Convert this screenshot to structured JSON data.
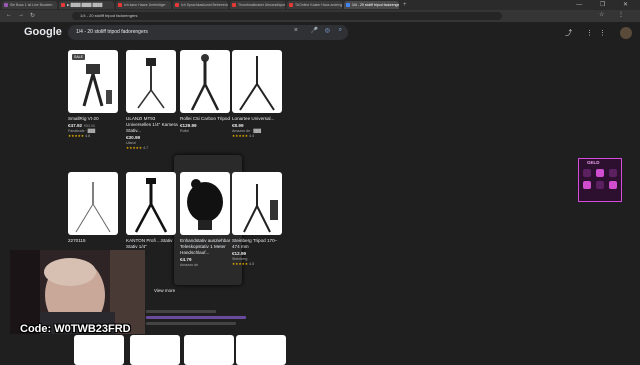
{
  "browser": {
    "tabs": [
      {
        "label": "Sie Boss 1 ist Live Boosten",
        "color": "#9b59b6",
        "active": false
      },
      {
        "label": "▶ ████ ████ ████",
        "color": "#e53935",
        "active": false
      },
      {
        "label": "Ich kann Haare Umfeldiger",
        "color": "#e53935",
        "active": false
      },
      {
        "label": "Ich Sprachkaskunst Betreeedung",
        "color": "#e53935",
        "active": false
      },
      {
        "label": "Thumbnailmaker Alexandrique",
        "color": "#e53935",
        "active": false
      },
      {
        "label": "TAOnline Kaster Haus andringee",
        "color": "#e53935",
        "active": false
      },
      {
        "label": "1/4 - 20 stoliff tripod fadorengers",
        "color": "#4285f4",
        "active": true
      }
    ],
    "new_tab": "+",
    "url": "1/4 - 20 stoliff tripod fadorengers"
  },
  "google": {
    "logo": "Google",
    "query": "1/4 - 20 stoliff tripod fadorengers"
  },
  "products": [
    {
      "name": "SmallRig Vt-20",
      "price": "€47.92",
      "old": "€53.00",
      "store": "Fanaticals · ███",
      "rating": "4.6",
      "badge": "SALE"
    },
    {
      "name": "ULANZI MT93 Universelles 1/4\" Kamera Stativ...",
      "price": "€30.99",
      "old": "",
      "store": "Ulanzi",
      "rating": "4.7",
      "badge": ""
    },
    {
      "name": "Rollei C5i Carbon Tripod",
      "price": "€129.99",
      "old": "",
      "store": "Rollei",
      "rating": "",
      "badge": ""
    },
    {
      "name": "Lonartee Universal...",
      "price": "€8.99",
      "old": "",
      "store": "Amazon.de · ███",
      "rating": "4.4",
      "badge": ""
    },
    {
      "name": "2270115",
      "price": "",
      "old": "",
      "store": "",
      "rating": "",
      "badge": ""
    },
    {
      "name": "KANTON Profi ...Stativ Stativ 1/4\"",
      "price": "",
      "old": "",
      "store": "",
      "rating": "",
      "badge": ""
    },
    {
      "name": "Enhandstativ ausziehbar Teleskopstativ 1 Meter Handschlauf...",
      "price": "€4.79",
      "old": "",
      "store": "Amazon.de",
      "rating": "",
      "badge": ""
    },
    {
      "name": "Steinberg Tripod 170–474 mm",
      "price": "€12.99",
      "old": "",
      "store": "Steinberg",
      "rating": "4.5",
      "badge": ""
    }
  ],
  "view_more": "View more",
  "overlay": {
    "code_text": "Code: W0TWB23FRD",
    "widget_title": "GELD"
  }
}
